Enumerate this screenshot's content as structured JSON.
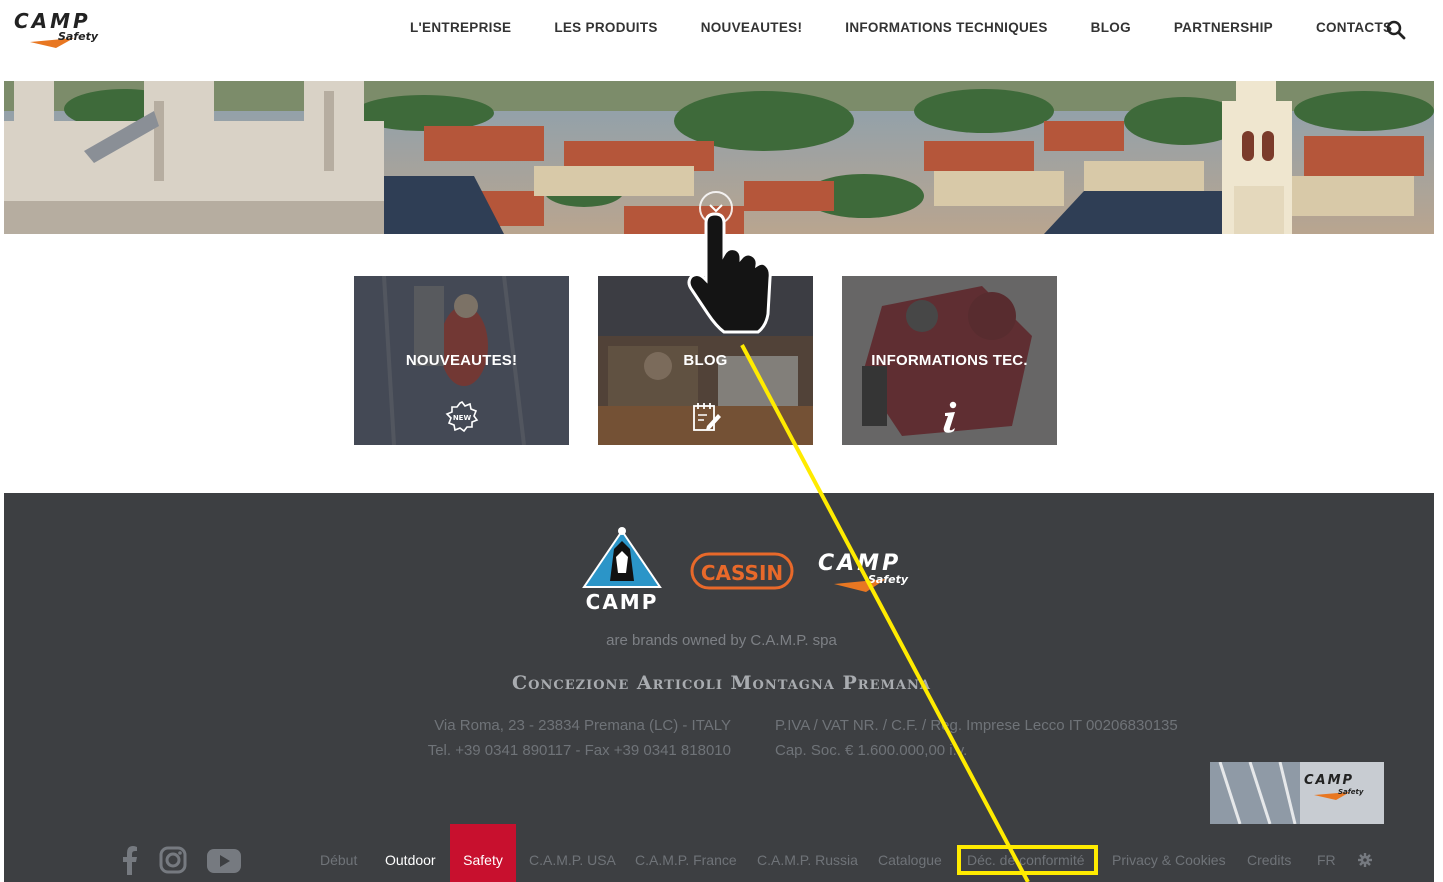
{
  "header": {
    "logo_text": "CAMP",
    "logo_sub": "Safety",
    "nav": [
      {
        "label": "L'ENTREPRISE"
      },
      {
        "label": "LES PRODUITS"
      },
      {
        "label": "NOUVEAUTES!"
      },
      {
        "label": "INFORMATIONS TECHNIQUES"
      },
      {
        "label": "BLOG"
      },
      {
        "label": "PARTNERSHIP"
      },
      {
        "label": "CONTACTS"
      }
    ],
    "search_icon": "search-icon"
  },
  "tiles": [
    {
      "label": "NOUVEAUTES!",
      "icon": "new-badge-icon"
    },
    {
      "label": "BLOG",
      "icon": "edit-note-icon"
    },
    {
      "label": "INFORMATIONS TEC.",
      "icon": "info-icon"
    }
  ],
  "footer": {
    "brands": {
      "camp": "CAMP",
      "cassin": "CASSIN",
      "safety_main": "CAMP",
      "safety_sub": "Safety"
    },
    "tagline": "are brands owned by C.A.M.P. spa",
    "company": "Concezione Articoli Montagna Premana",
    "address_left": [
      "Via Roma, 23 - 23834 Premana (LC) - ITALY",
      "Tel. +39 0341 890117 - Fax +39 0341 818010"
    ],
    "address_right": [
      "P.IVA / VAT NR. / C.F. / Reg. Imprese Lecco IT 00206830135",
      "Cap. Soc. € 1.600.000,00 i.v."
    ],
    "badge_main": "CAMP",
    "badge_sub": "Safety",
    "social": [
      "facebook-icon",
      "instagram-icon",
      "youtube-icon"
    ],
    "links": {
      "debut": "Début",
      "outdoor": "Outdoor",
      "safety": "Safety",
      "usa": "C.A.M.P. USA",
      "france": "C.A.M.P. France",
      "russia": "C.A.M.P. Russia",
      "catalogue": "Catalogue",
      "conformite": "Déc. de conformité",
      "privacy": "Privacy & Cookies",
      "credits": "Credits",
      "lang": "FR"
    },
    "colors": {
      "footer_bg": "#3d3f42",
      "safety_tab": "#c8102e",
      "highlight": "#ffeb00"
    }
  }
}
